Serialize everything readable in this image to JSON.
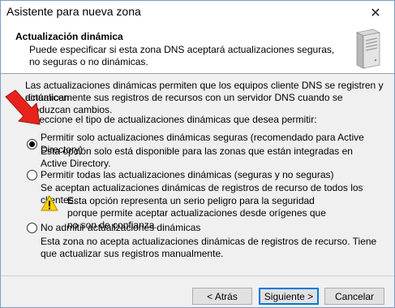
{
  "window": {
    "title": "Asistente para nueva zona",
    "close_glyph": "✕"
  },
  "header": {
    "title": "Actualización dinámica",
    "description": "Puede especificar si esta zona DNS aceptará actualizaciones seguras, no seguras o no dinámicas."
  },
  "intro": {
    "line1": "Las actualizaciones dinámicas permiten que los equipos cliente DNS se registren y actualicen",
    "line2": "dinámicamente sus registros de recursos con un servidor DNS cuando se produzcan cambios.",
    "prompt": "Seleccione el tipo de actualizaciones dinámicas que desea permitir:"
  },
  "options": [
    {
      "label": "Permitir solo actualizaciones dinámicas seguras (recomendado para Active Directory)",
      "description": "Esta opción solo está disponible para las zonas que están integradas en Active Directory.",
      "checked": true
    },
    {
      "label": "Permitir todas las actualizaciones dinámicas (seguras y no seguras)",
      "description": "Se aceptan actualizaciones dinámicas de registros de recurso de todos los clientes.",
      "warning": "Esta opción representa un serio peligro para la seguridad porque permite aceptar actualizaciones desde orígenes que no son de confianza.",
      "checked": false
    },
    {
      "label": "No admitir actualizaciones dinámicas",
      "description": "Esta zona no acepta actualizaciones dinámicas de registros de recurso. Tiene que actualizar sus registros manualmente.",
      "checked": false
    }
  ],
  "buttons": {
    "back": "< Atrás",
    "next": "Siguiente >",
    "cancel": "Cancelar"
  },
  "icons": {
    "header": "server-icon",
    "warning": "warning-icon",
    "annotation": "red-arrow-icon"
  },
  "colors": {
    "annotation_arrow": "#e8231c",
    "default_button_border": "#0078d7"
  }
}
